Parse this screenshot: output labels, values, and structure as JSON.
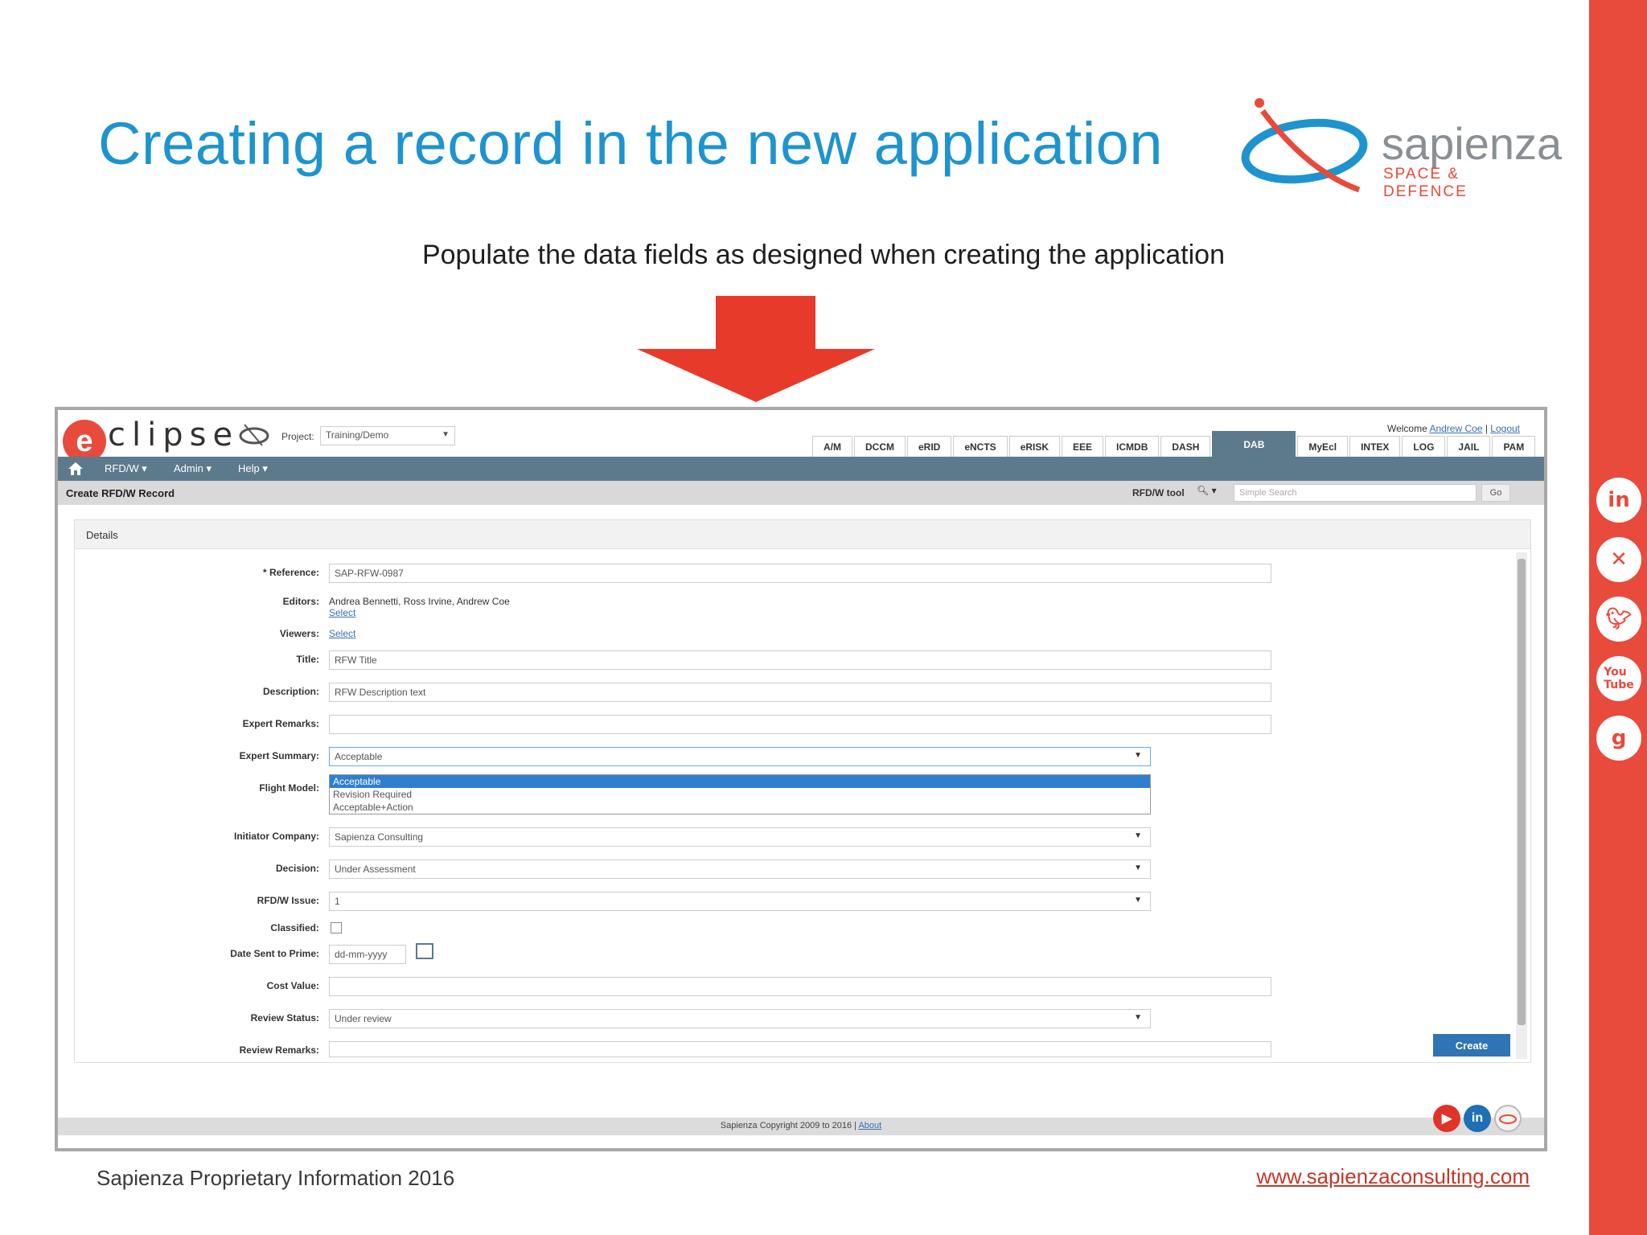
{
  "slide": {
    "title": "Creating a record in the new application",
    "subtitle": "Populate the data fields as designed when creating the application",
    "footer_left": "Sapienza Proprietary Information 2016",
    "footer_right": "www.sapienzaconsulting.com",
    "logo_word": "sapienza",
    "logo_sub": "SPACE & DEFENCE",
    "accent_color": "#e84a3b",
    "title_color": "#1d94cf",
    "social_icons": [
      "linkedin-icon",
      "xing-icon",
      "twitter-icon",
      "youtube-icon",
      "google-plus-icon"
    ]
  },
  "app": {
    "brand_letter": "e",
    "brand_word": "clipse",
    "project_label": "Project:",
    "project_value": "Training/Demo",
    "welcome_text": "Welcome",
    "welcome_user": "Andrew Coe",
    "logout": "Logout",
    "tabs": [
      "A/M",
      "DCCM",
      "eRID",
      "eNCTS",
      "eRISK",
      "EEE",
      "ICMDB",
      "DASH",
      "DAB",
      "MyEcl",
      "INTEX",
      "LOG",
      "JAIL",
      "PAM"
    ],
    "active_tab": "DAB",
    "menu": [
      "RFD/W ▾",
      "Admin ▾",
      "Help ▾"
    ],
    "page_title": "Create RFD/W Record",
    "tool_label": "RFD/W tool",
    "search_placeholder": "Simple Search",
    "go_label": "Go",
    "panel_title": "Details",
    "fields": {
      "reference_label": "* Reference:",
      "reference_value": "SAP-RFW-0987",
      "editors_label": "Editors:",
      "editors_value": "Andrea Bennetti, Ross Irvine, Andrew Coe",
      "editors_select": "Select",
      "viewers_label": "Viewers:",
      "viewers_select": "Select",
      "title_label": "Title:",
      "title_value": "RFW Title",
      "description_label": "Description:",
      "description_value": "RFW Description text",
      "expert_remarks_label": "Expert Remarks:",
      "expert_remarks_value": "",
      "expert_summary_label": "Expert Summary:",
      "expert_summary_value": "Acceptable",
      "expert_summary_options": [
        "Acceptable",
        "Revision Required",
        "Acceptable+Action"
      ],
      "flight_model_label": "Flight Model:",
      "initiator_company_label": "Initiator Company:",
      "initiator_company_value": "Sapienza Consulting",
      "decision_label": "Decision:",
      "decision_value": "Under Assessment",
      "issue_label": "RFD/W Issue:",
      "issue_value": "1",
      "classified_label": "Classified:",
      "date_label": "Date Sent to Prime:",
      "date_placeholder": "dd-mm-yyyy",
      "cost_label": "Cost Value:",
      "review_status_label": "Review Status:",
      "review_status_value": "Under review",
      "review_remarks_label": "Review Remarks:"
    },
    "create_label": "Create",
    "copyright": "Sapienza Copyright 2009 to 2016 |",
    "about": "About"
  }
}
